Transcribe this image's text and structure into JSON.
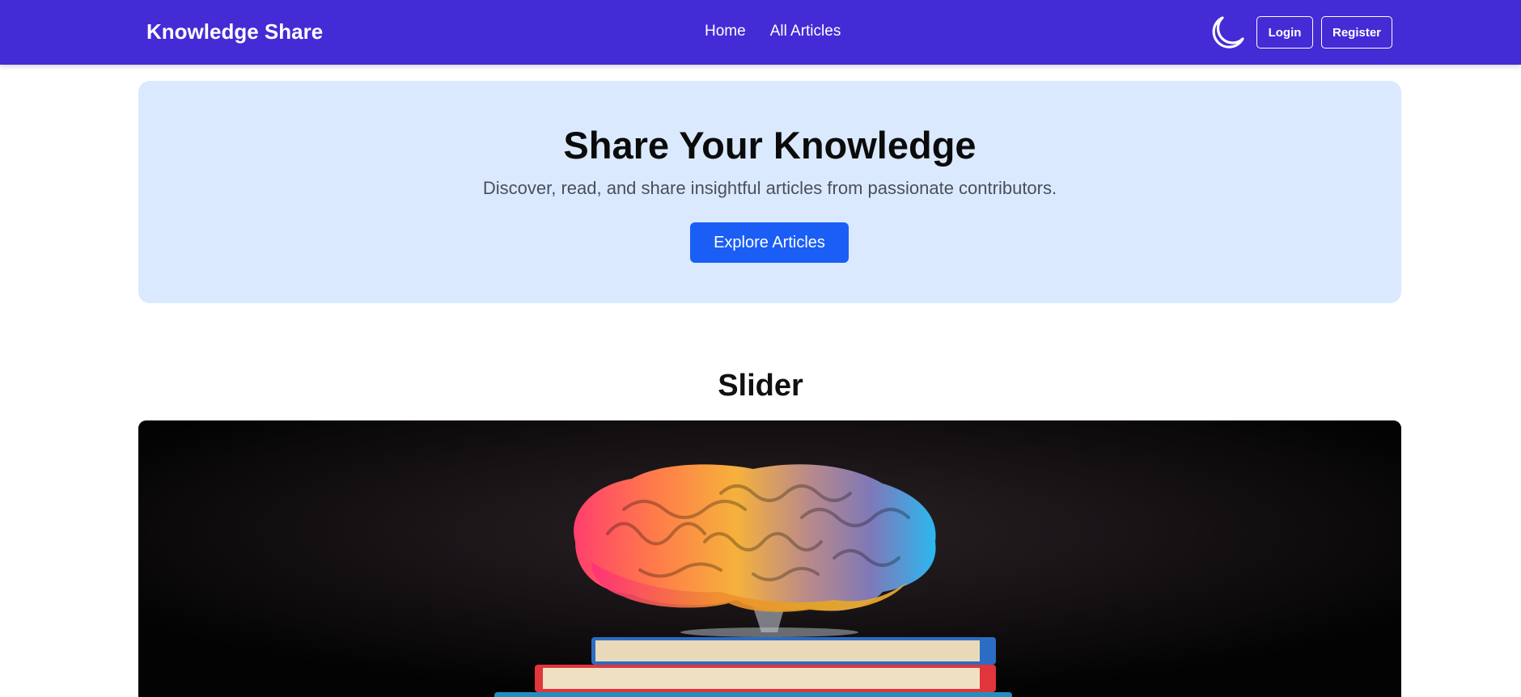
{
  "navbar": {
    "brand": "Knowledge Share",
    "links": [
      {
        "label": "Home"
      },
      {
        "label": "All Articles"
      }
    ],
    "theme_icon": "moon-icon",
    "login_label": "Login",
    "register_label": "Register",
    "background": "#432bd6"
  },
  "hero": {
    "title": "Share Your Knowledge",
    "subtitle": "Discover, read, and share insightful articles from passionate contributors.",
    "cta_label": "Explore Articles",
    "background": "#dbe9fe",
    "cta_color": "#1a5ef5"
  },
  "slider": {
    "heading": "Slider",
    "slide_image": "brain-on-books-image"
  }
}
